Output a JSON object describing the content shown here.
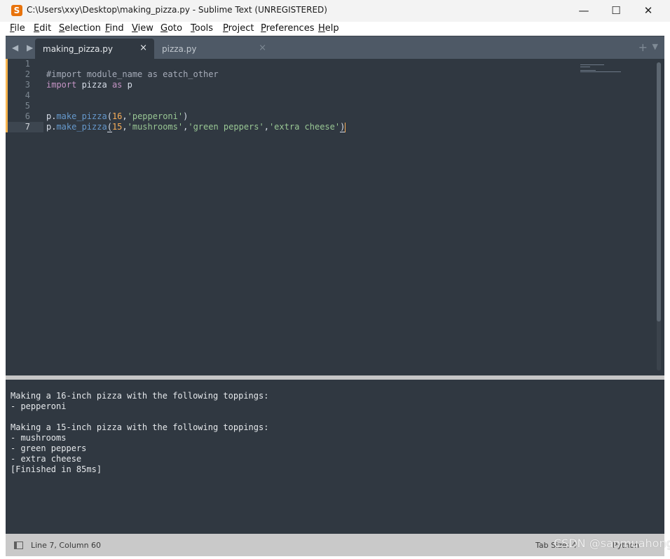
{
  "window": {
    "title": "C:\\Users\\xxy\\Desktop\\making_pizza.py - Sublime Text (UNREGISTERED)",
    "controls": {
      "minimize": "—",
      "maximize": "☐",
      "close": "✕"
    }
  },
  "menu": [
    {
      "key": "F",
      "rest": "ile"
    },
    {
      "key": "E",
      "rest": "dit"
    },
    {
      "key": "S",
      "rest": "election"
    },
    {
      "key": "F",
      "rest": "ind"
    },
    {
      "key": "V",
      "rest": "iew"
    },
    {
      "key": "G",
      "rest": "oto"
    },
    {
      "key": "T",
      "rest": "ools"
    },
    {
      "key": "P",
      "rest": "roject"
    },
    {
      "key": "P",
      "rest": "references"
    },
    {
      "key": "H",
      "rest": "elp"
    }
  ],
  "tabs": [
    {
      "label": "making_pizza.py",
      "close": "×",
      "active": true
    },
    {
      "label": "pizza.py",
      "close": "×",
      "active": false
    }
  ],
  "tabbar_icons": {
    "nav": "◀ ▶",
    "add": "+",
    "menu": "▼"
  },
  "editor": {
    "line_numbers": [
      "1",
      "2",
      "3",
      "4",
      "5",
      "6",
      "7"
    ],
    "current_line": 7,
    "lines": [
      [],
      [
        {
          "t": "#import module_name as eatch_other",
          "c": "c-comment"
        }
      ],
      [
        {
          "t": "import",
          "c": "c-kw"
        },
        {
          "t": " pizza ",
          "c": "c-plain"
        },
        {
          "t": "as",
          "c": "c-kw"
        },
        {
          "t": " p",
          "c": "c-plain"
        }
      ],
      [],
      [],
      [
        {
          "t": "p.",
          "c": "c-plain"
        },
        {
          "t": "make_pizza",
          "c": "c-fn"
        },
        {
          "t": "(",
          "c": "c-plain"
        },
        {
          "t": "16",
          "c": "c-num"
        },
        {
          "t": ",",
          "c": "c-plain"
        },
        {
          "t": "'pepperoni'",
          "c": "c-str"
        },
        {
          "t": ")",
          "c": "c-plain"
        }
      ],
      [
        {
          "t": "p.",
          "c": "c-plain"
        },
        {
          "t": "make_pizza",
          "c": "c-fn"
        },
        {
          "t": "(",
          "c": "c-plain bracket"
        },
        {
          "t": "15",
          "c": "c-num"
        },
        {
          "t": ",",
          "c": "c-plain"
        },
        {
          "t": "'mushrooms'",
          "c": "c-str"
        },
        {
          "t": ",",
          "c": "c-plain"
        },
        {
          "t": "'green peppers'",
          "c": "c-str"
        },
        {
          "t": ",",
          "c": "c-plain"
        },
        {
          "t": "'extra cheese'",
          "c": "c-str"
        },
        {
          "t": ")",
          "c": "c-plain bracket"
        }
      ]
    ]
  },
  "output": {
    "lines": [
      "",
      "Making a 16-inch pizza with the following toppings:",
      "- pepperoni",
      "",
      "Making a 15-inch pizza with the following toppings:",
      "- mushrooms",
      "- green peppers",
      "- extra cheese",
      "[Finished in 85ms]"
    ]
  },
  "status": {
    "position": "Line 7, Column 60",
    "tab_size": "Tab Size: 4",
    "syntax": "Python"
  },
  "watermark": "CSDN @sanmuahong",
  "colors": {
    "editor_bg": "#303841",
    "tabbar_bg": "#4e5966",
    "comment": "#a6acb9",
    "keyword": "#c594c5",
    "function": "#6699cc",
    "number": "#f9ae58",
    "string": "#99c794",
    "modified_marker": "#f7b44f"
  }
}
